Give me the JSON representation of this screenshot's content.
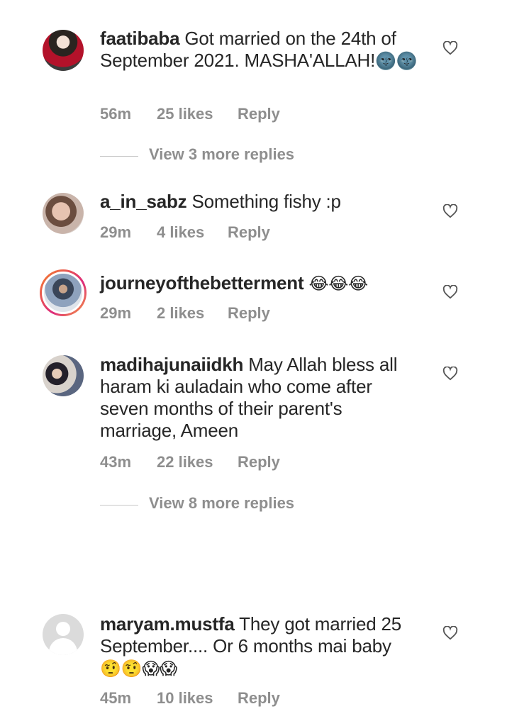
{
  "comments": [
    {
      "username": "faatibaba",
      "text": "Got married on the 24th of September 2021. MASHA'ALLAH!",
      "emoji": "🌚🌚",
      "time": "56m",
      "likes": "25 likes",
      "reply": "Reply"
    },
    {
      "username": "a_in_sabz",
      "text": "Something fishy :p",
      "emoji": "",
      "time": "29m",
      "likes": "4 likes",
      "reply": "Reply"
    },
    {
      "username": "journeyofthebetterment",
      "text": "",
      "emoji": "😂😂😂",
      "time": "29m",
      "likes": "2 likes",
      "reply": "Reply"
    },
    {
      "username": "madihajunaiidkh",
      "text": "May Allah bless all haram ki auladain who come after seven months of their parent's marriage, Ameen",
      "emoji": "",
      "time": "43m",
      "likes": "22 likes",
      "reply": "Reply"
    },
    {
      "username": "maryam.mustfa",
      "text": "They got married 25 September.... Or 6 months mai baby",
      "emoji": "🤨🤨😱😱",
      "time": "45m",
      "likes": "10 likes",
      "reply": "Reply"
    }
  ],
  "view_more": [
    "View 3 more replies",
    "View 8 more replies"
  ],
  "icons": {
    "like": "heart-outline-icon"
  },
  "colors": {
    "text": "#262626",
    "secondary": "#8e8e8e",
    "divider": "#c7c7c7"
  }
}
